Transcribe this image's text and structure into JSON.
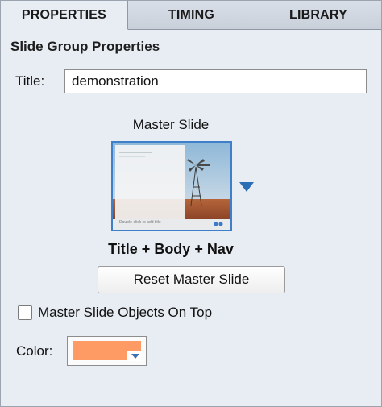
{
  "tabs": [
    {
      "label": "PROPERTIES",
      "active": true
    },
    {
      "label": "TIMING",
      "active": false
    },
    {
      "label": "LIBRARY",
      "active": false
    }
  ],
  "section": {
    "title": "Slide Group Properties"
  },
  "title_field": {
    "label": "Title:",
    "value": "demonstration"
  },
  "master": {
    "label": "Master Slide",
    "thumbnail_text": "Double-click to add title",
    "layout_name": "Title + Body + Nav",
    "reset_label": "Reset Master Slide"
  },
  "objects_on_top": {
    "label": "Master Slide Objects On Top",
    "checked": false
  },
  "color": {
    "label": "Color:",
    "value": "#fe9a63"
  },
  "colors": {
    "accent": "#2a6fb6",
    "thumb_border": "#3f7ec9"
  }
}
